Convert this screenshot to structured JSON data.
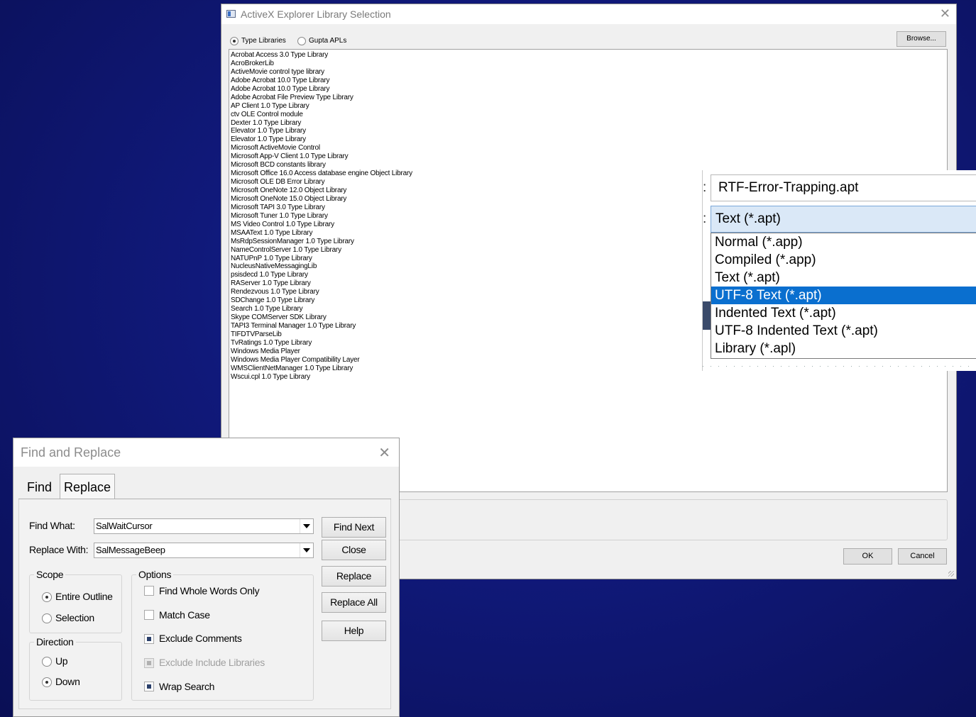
{
  "activex": {
    "title": "ActiveX Explorer Library Selection",
    "close_glyph": "✕",
    "radio_type_libraries": "Type Libraries",
    "radio_gupta_apls": "Gupta APLs",
    "browse_label": "Browse...",
    "libraries": [
      "Acrobat Access 3.0 Type Library",
      "AcroBrokerLib",
      "ActiveMovie control type library",
      "Adobe Acrobat 10.0 Type Library",
      "Adobe Acrobat 10.0 Type Library",
      "Adobe Acrobat File Preview Type Library",
      "AP Client 1.0 Type Library",
      "ctv OLE Control module",
      "Dexter 1.0 Type Library",
      "Elevator 1.0 Type Library",
      "Elevator 1.0 Type Library",
      "Microsoft ActiveMovie Control",
      "Microsoft App-V Client 1.0 Type Library",
      "Microsoft BCD constants library",
      "Microsoft Office 16.0 Access database engine Object Library",
      "Microsoft OLE DB Error Library",
      "Microsoft OneNote 12.0 Object Library",
      "Microsoft OneNote 15.0 Object Library",
      "Microsoft TAPI 3.0 Type Library",
      "Microsoft Tuner 1.0 Type Library",
      "MS Video Control 1.0 Type Library",
      "MSAAText 1.0 Type Library",
      "MsRdpSessionManager 1.0 Type Library",
      "NameControlServer 1.0 Type Library",
      "NATUPnP 1.0 Type Library",
      "NucleusNativeMessagingLib",
      "psisdecd 1.0 Type Library",
      "RAServer 1.0 Type Library",
      "Rendezvous 1.0 Type Library",
      "SDChange 1.0 Type Library",
      "Search 1.0 Type Library",
      "Skype COMServer SDK Library",
      "TAPI3 Terminal Manager 1.0 Type Library",
      "TIFDTVParseLib",
      "TvRatings 1.0 Type Library",
      "Windows Media Player",
      "Windows Media Player Compatibility Layer",
      "WMSClientNetManager 1.0 Type Library",
      "Wscui.cpl 1.0 Type Library"
    ],
    "ok_label": "OK",
    "cancel_label": "Cancel"
  },
  "file_type": {
    "colon": ":",
    "filename": "RTF-Error-Trapping.apt",
    "selected_type": "Text (*.apt)",
    "options": [
      "Normal (*.app)",
      "Compiled (*.app)",
      "Text (*.apt)",
      "UTF-8 Text (*.apt)",
      "Indented Text (*.apt)",
      "UTF-8 Indented Text (*.apt)",
      "Library (*.apl)"
    ],
    "highlighted_index": 3
  },
  "find_replace": {
    "title": "Find and Replace",
    "close_glyph": "✕",
    "tab_find": "Find",
    "tab_replace": "Replace",
    "find_what_label": "Find What:",
    "find_what_value": "SalWaitCursor",
    "replace_with_label": "Replace With:",
    "replace_with_value": "SalMessageBeep",
    "buttons": {
      "find_next": "Find Next",
      "close": "Close",
      "replace": "Replace",
      "replace_all": "Replace All",
      "help": "Help"
    },
    "scope": {
      "title": "Scope",
      "entire_outline": "Entire Outline",
      "selection": "Selection"
    },
    "direction": {
      "title": "Direction",
      "up": "Up",
      "down": "Down"
    },
    "options": {
      "title": "Options",
      "find_whole_words_only": "Find Whole Words Only",
      "match_case": "Match Case",
      "exclude_comments": "Exclude Comments",
      "exclude_include_libraries": "Exclude Include Libraries",
      "wrap_search": "Wrap Search"
    }
  }
}
